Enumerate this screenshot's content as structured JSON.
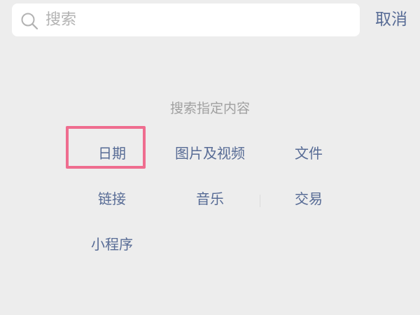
{
  "search": {
    "placeholder": "搜索",
    "icon": "search-icon",
    "cancel_label": "取消"
  },
  "hint": "搜索指定内容",
  "options": [
    {
      "label": "日期"
    },
    {
      "label": "图片及视频"
    },
    {
      "label": "文件"
    },
    {
      "label": "链接"
    },
    {
      "label": "音乐"
    },
    {
      "label": "交易"
    },
    {
      "label": "小程序"
    }
  ],
  "colors": {
    "background": "#ededed",
    "link": "#576b95",
    "hint": "#a0a0a0",
    "highlight": "#ef6d8f"
  }
}
